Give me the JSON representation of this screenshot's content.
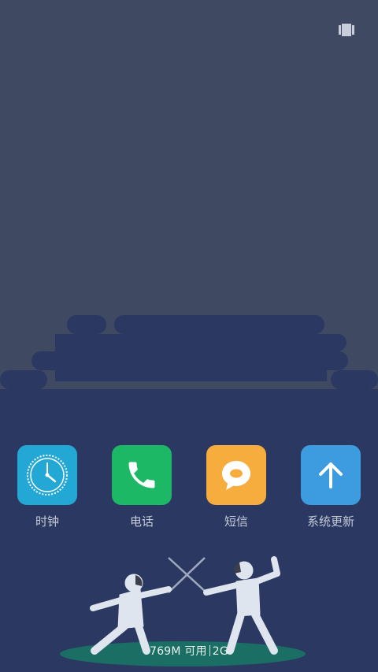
{
  "status": {
    "recents_icon": "recent-apps-icon"
  },
  "apps": [
    {
      "label": "时钟",
      "icon": "clock-icon",
      "color": "#23a8d6"
    },
    {
      "label": "电话",
      "icon": "phone-icon",
      "color": "#1db865"
    },
    {
      "label": "短信",
      "icon": "message-icon",
      "color": "#f7ad3e"
    },
    {
      "label": "系统更新",
      "icon": "arrow-up-icon",
      "color": "#3d9be0"
    }
  ],
  "memory": {
    "available": "769M 可用",
    "total": "2G"
  },
  "colors": {
    "sky": "#3f4a62",
    "ground": "#2b3861",
    "accent": "#1a6e63"
  }
}
